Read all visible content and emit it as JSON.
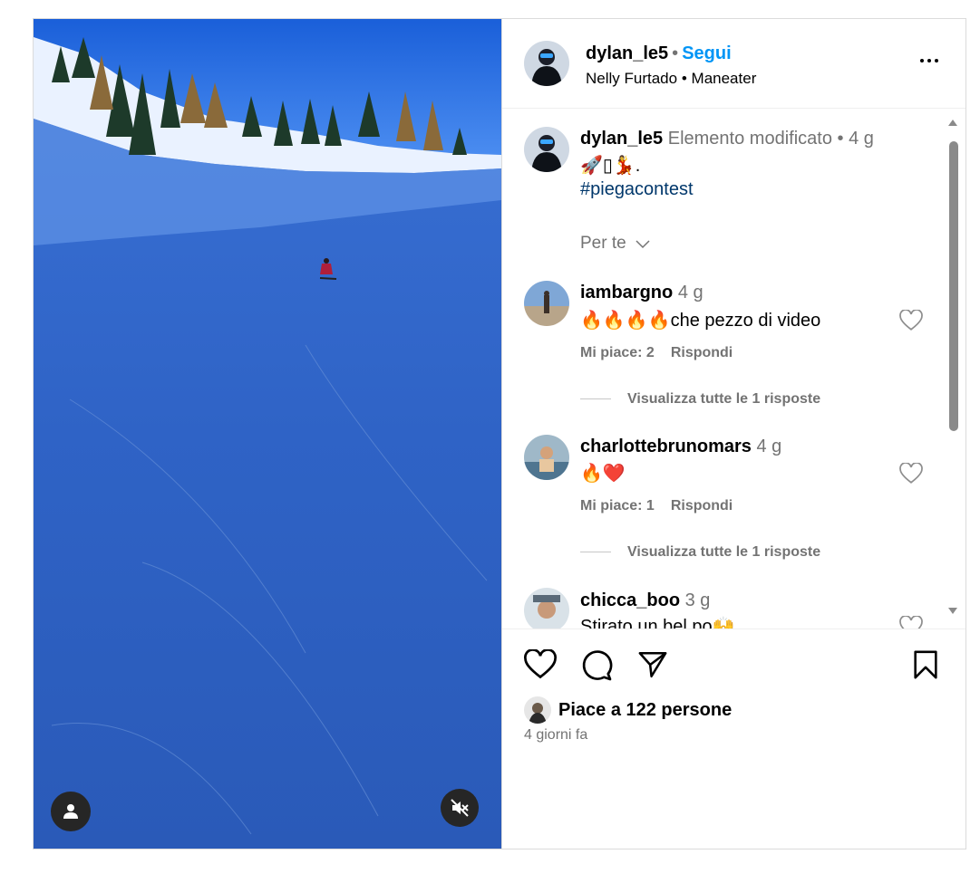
{
  "header": {
    "username": "dylan_le5",
    "follow_label": "Segui",
    "separator": "•",
    "audio_artist": "Nelly Furtado",
    "audio_title": "Maneater"
  },
  "caption": {
    "username": "dylan_le5",
    "edited_label": "Elemento modificato",
    "separator": "•",
    "time": "4 g",
    "emojis": "🚀▯💃.",
    "hashtag": "#piegacontest",
    "sort_label": "Per te"
  },
  "comments": [
    {
      "username": "iambargno",
      "time": "4 g",
      "text": "🔥🔥🔥🔥che pezzo di video",
      "likes": "Mi piace: 2",
      "reply_label": "Rispondi",
      "view_replies": "Visualizza tutte le 1 risposte"
    },
    {
      "username": "charlottebrunomars",
      "time": "4 g",
      "text": "🔥❤️",
      "likes": "Mi piace: 1",
      "reply_label": "Rispondi",
      "view_replies": "Visualizza tutte le 1 risposte"
    },
    {
      "username": "chicca_boo",
      "time": "3 g",
      "text": "Stirato un bel po🙌"
    }
  ],
  "footer": {
    "likes_text": "Piace a 122 persone",
    "posted_ago": "4 giorni fa"
  },
  "icons": {
    "more": "more-options-icon",
    "like": "heart-icon",
    "comment": "comment-icon",
    "share": "share-icon",
    "save": "bookmark-icon",
    "tag": "user-tag-icon",
    "mute": "muted-speaker-icon"
  },
  "colors": {
    "accent": "#0095f6",
    "hashtag": "#00376b",
    "secondary_text": "#737373",
    "border": "#dbdbdb"
  }
}
